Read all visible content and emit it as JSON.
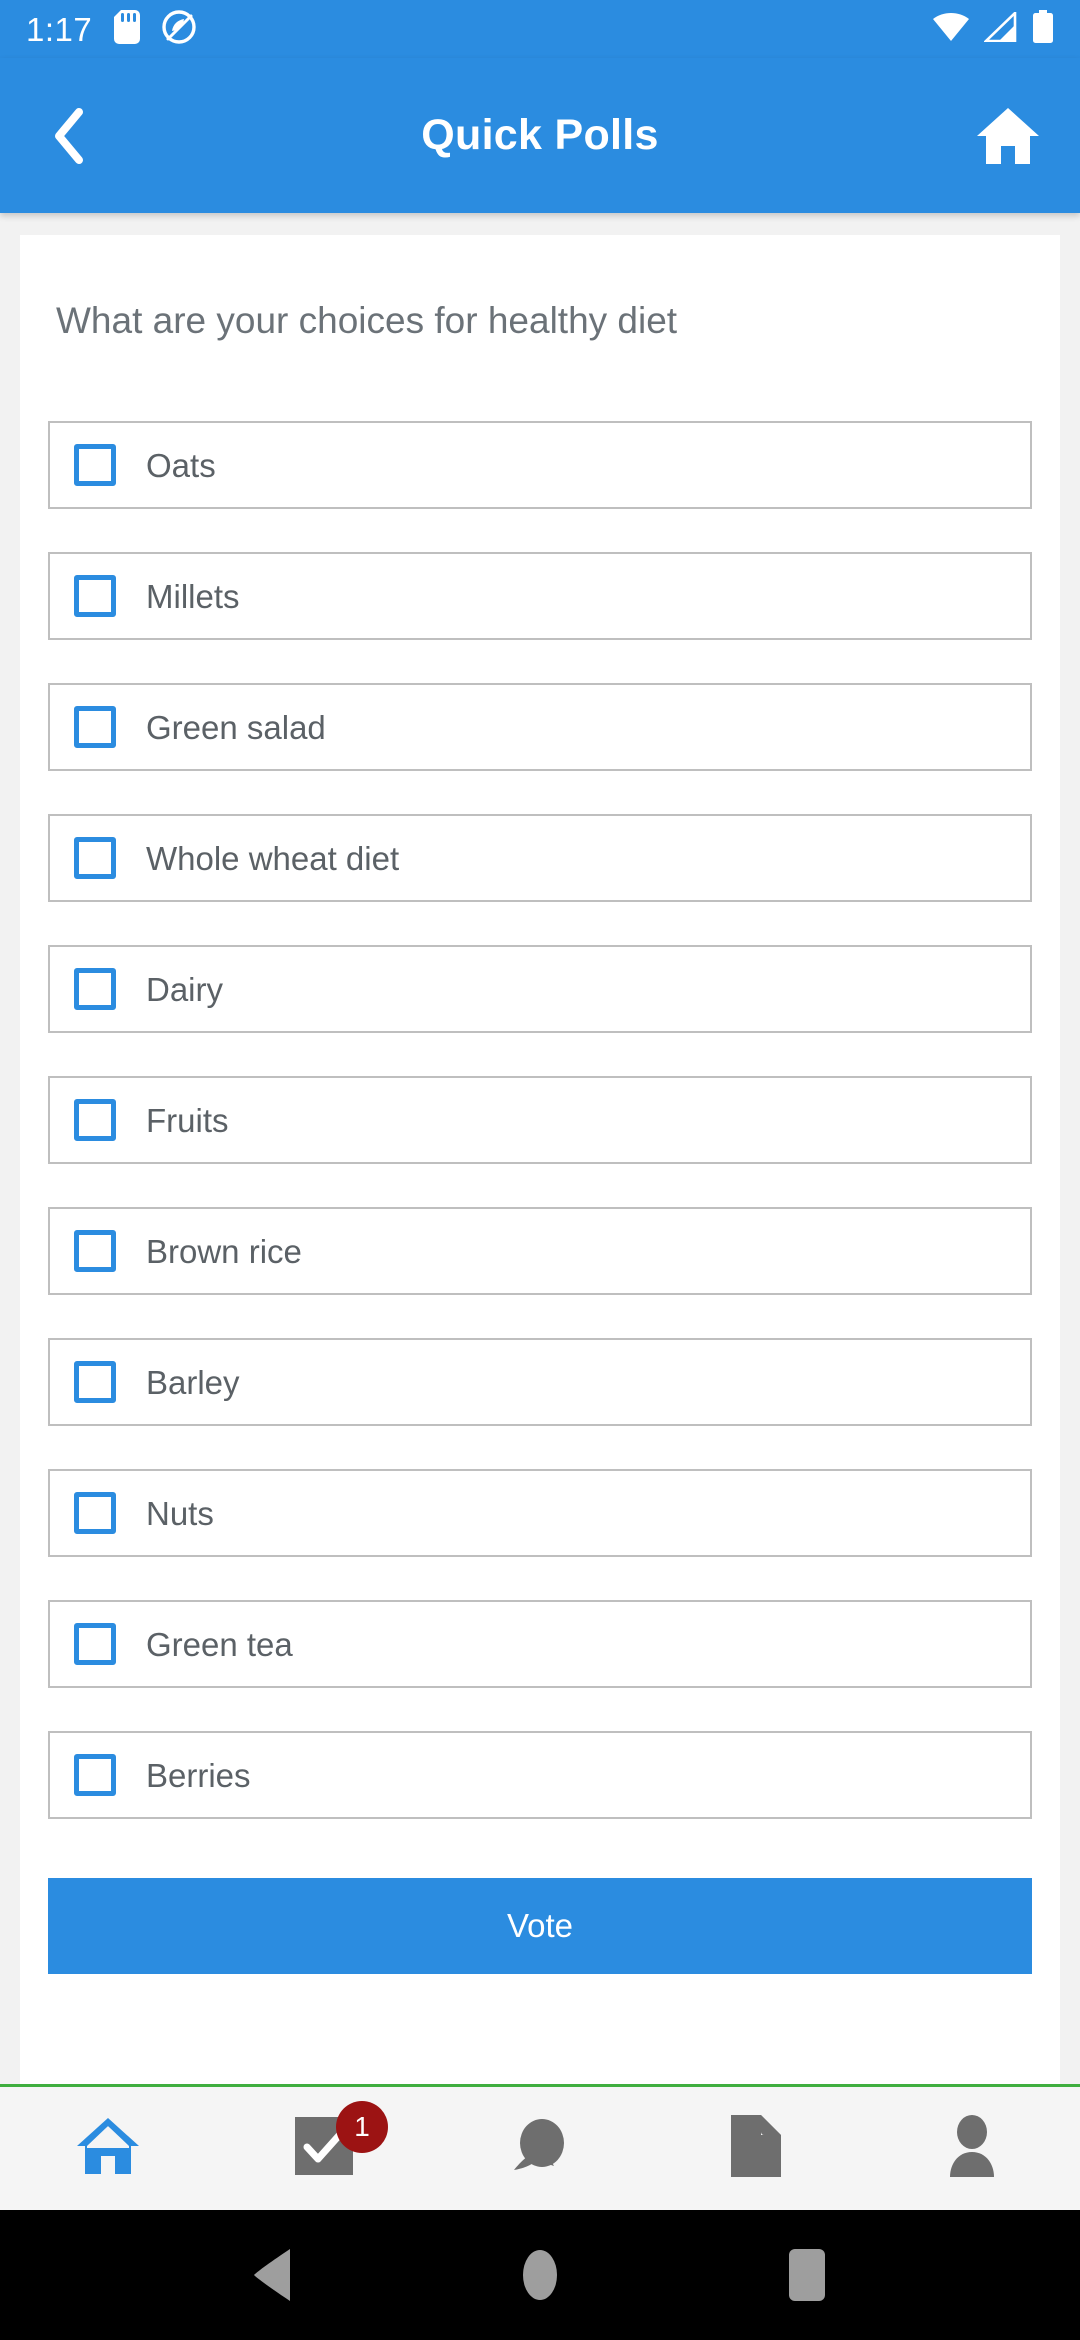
{
  "status_bar": {
    "time": "1:17",
    "left_icons": [
      "sd-card-icon",
      "data-saver-icon"
    ],
    "right_icons": [
      "wifi-icon",
      "cellular-signal-icon",
      "battery-icon"
    ]
  },
  "app_bar": {
    "back_icon": "chevron-left-icon",
    "title": "Quick Polls",
    "home_icon": "home-icon",
    "background_color": "#2b8ce0"
  },
  "poll": {
    "question": "What are your choices for healthy diet",
    "options": [
      {
        "label": "Oats",
        "checked": false
      },
      {
        "label": "Millets",
        "checked": false
      },
      {
        "label": "Green salad",
        "checked": false
      },
      {
        "label": "Whole wheat diet",
        "checked": false
      },
      {
        "label": "Dairy",
        "checked": false
      },
      {
        "label": "Fruits",
        "checked": false
      },
      {
        "label": "Brown rice",
        "checked": false
      },
      {
        "label": "Barley",
        "checked": false
      },
      {
        "label": "Nuts",
        "checked": false
      },
      {
        "label": "Green tea",
        "checked": false
      },
      {
        "label": "Berries",
        "checked": false
      }
    ],
    "vote_label": "Vote",
    "vote_color": "#2b8ce0",
    "checkbox_color": "#2b8ce0"
  },
  "bottom_nav": {
    "accent_line_color": "#3fae3f",
    "items": [
      {
        "icon": "home-icon",
        "active": true,
        "badge": null
      },
      {
        "icon": "tasks-check-icon",
        "active": false,
        "badge": "1"
      },
      {
        "icon": "chat-bubble-icon",
        "active": false,
        "badge": null
      },
      {
        "icon": "document-icon",
        "active": false,
        "badge": null
      },
      {
        "icon": "person-icon",
        "active": false,
        "badge": null
      }
    ],
    "badge_color": "#9c1313",
    "active_color": "#2b8ce0",
    "inactive_color": "#6e6e6e"
  },
  "android_nav": {
    "buttons": [
      "back-triangle-icon",
      "home-circle-icon",
      "recents-square-icon"
    ]
  }
}
